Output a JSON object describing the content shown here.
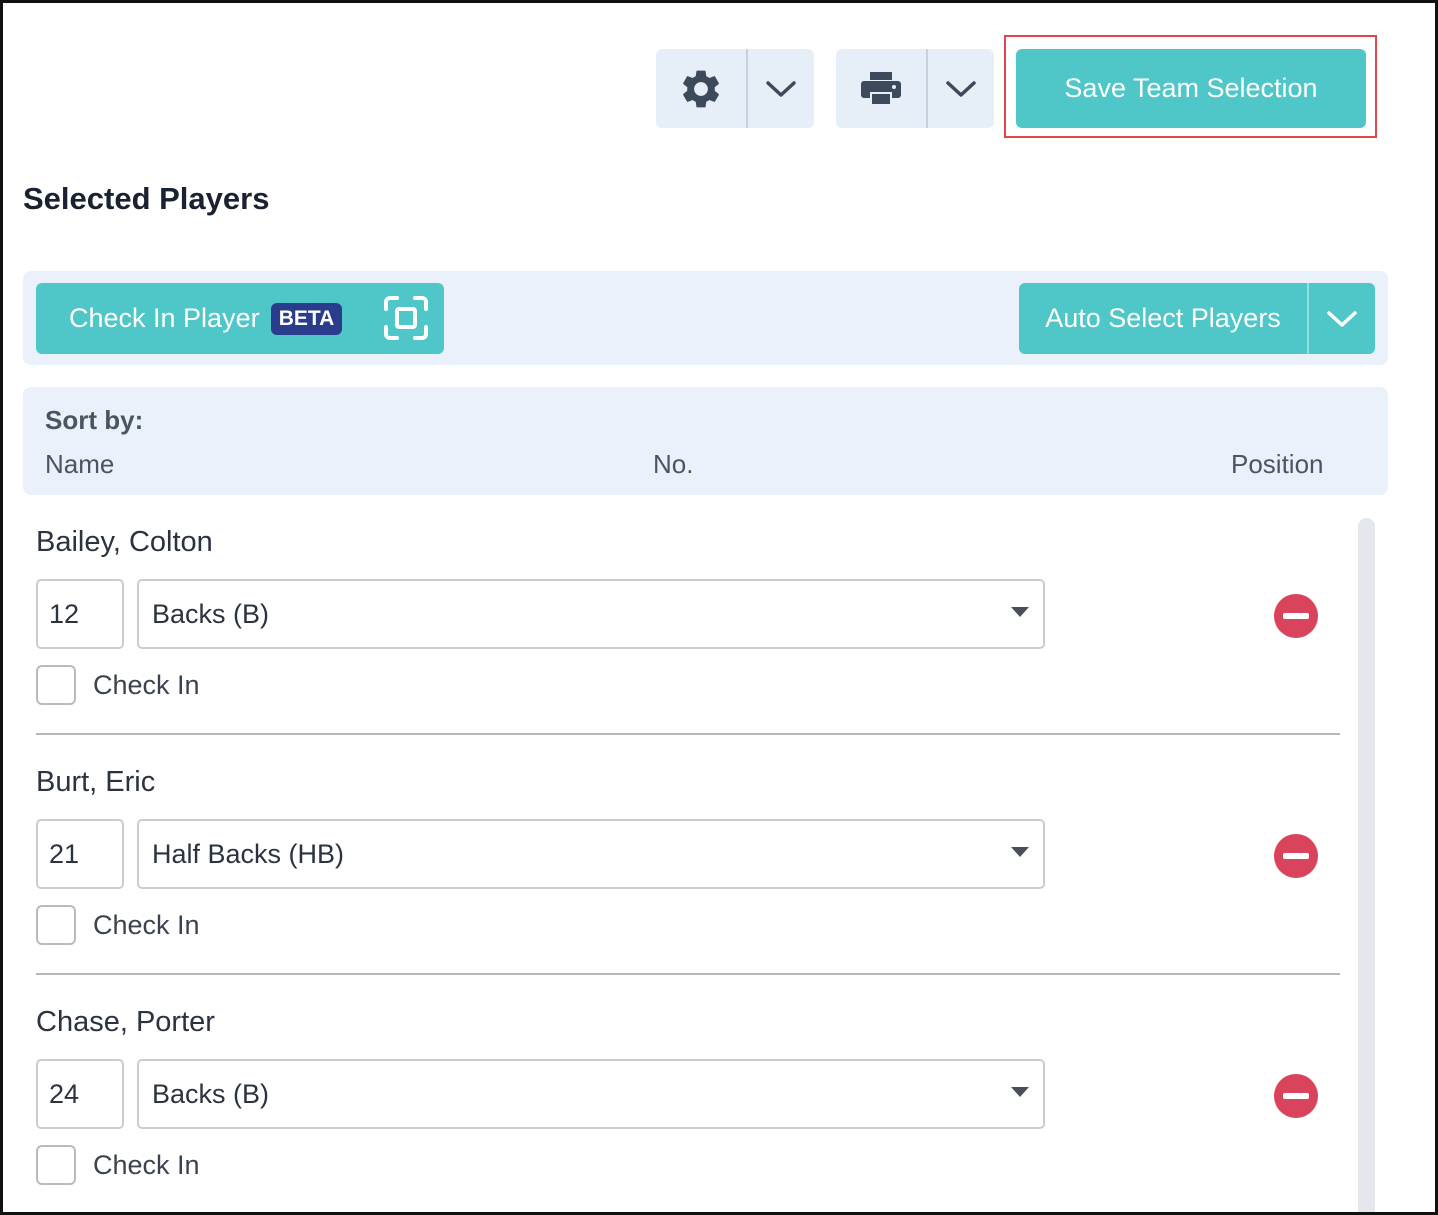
{
  "toolbar": {
    "settings_icon": "gear-icon",
    "settings_dropdown_icon": "chevron-down-icon",
    "print_icon": "printer-icon",
    "print_dropdown_icon": "chevron-down-icon",
    "save_label": "Save Team Selection"
  },
  "page_title": "Selected Players",
  "actions": {
    "check_in_label": "Check In Player",
    "beta_badge": "BETA",
    "scan_icon": "scan-icon",
    "auto_select_label": "Auto Select Players"
  },
  "sort": {
    "title": "Sort by:",
    "columns": [
      "Name",
      "No.",
      "Position"
    ]
  },
  "players": [
    {
      "name": "Bailey, Colton",
      "number": "12",
      "position": "Backs (B)",
      "check_in_label": "Check In",
      "checked": false
    },
    {
      "name": "Burt, Eric",
      "number": "21",
      "position": "Half Backs (HB)",
      "check_in_label": "Check In",
      "checked": false
    },
    {
      "name": "Chase, Porter",
      "number": "24",
      "position": "Backs (B)",
      "check_in_label": "Check In",
      "checked": false
    }
  ],
  "colors": {
    "accent": "#4fc6c8",
    "badge": "#2a3c8c",
    "remove": "#d9435c",
    "highlight": "#e0474c",
    "panel": "#eaf1fa"
  }
}
